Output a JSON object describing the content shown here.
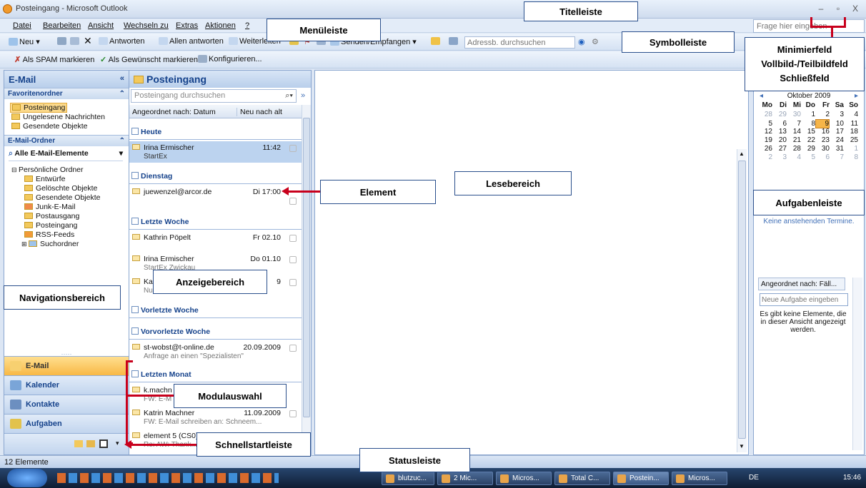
{
  "window": {
    "title": "Posteingang - Microsoft Outlook",
    "controls": [
      "–",
      "▫",
      "X"
    ]
  },
  "menu": [
    "Datei",
    "Bearbeiten",
    "Ansicht",
    "Wechseln zu",
    "Extras",
    "Aktionen",
    "?"
  ],
  "help_placeholder": "Frage hier eingeben",
  "toolbar1": {
    "new": "Neu",
    "reply": "Antworten",
    "reply_all": "Allen antworten",
    "forward": "Weiterleiten",
    "send_receive": "Senden/Empfangen",
    "address_search": "Adressb. durchsuchen"
  },
  "toolbar2": {
    "spam": "Als SPAM markieren",
    "wanted": "Als Gewünscht markieren",
    "configure": "Konfigurieren..."
  },
  "nav": {
    "title": "E-Mail",
    "favorites_header": "Favoritenordner",
    "favorites": [
      "Posteingang",
      "Ungelesene Nachrichten",
      "Gesendete Objekte"
    ],
    "mail_folders_header": "E-Mail-Ordner",
    "all_items": "Alle E-Mail-Elemente",
    "personal_folders": "Persönliche Ordner",
    "folders": [
      "Entwürfe",
      "Gelöschte Objekte",
      "Gesendete Objekte",
      "Junk-E-Mail",
      "Postausgang",
      "Posteingang",
      "RSS-Feeds",
      "Suchordner"
    ],
    "modules": [
      "E-Mail",
      "Kalender",
      "Kontakte",
      "Aufgaben"
    ]
  },
  "list": {
    "title": "Posteingang",
    "search_placeholder": "Posteingang durchsuchen",
    "sort_by": "Angeordnet nach: Datum",
    "sort_order": "Neu nach alt",
    "groups": [
      "Heute",
      "Dienstag",
      "Letzte Woche",
      "Vorletzte Woche",
      "Vorvorletzte Woche",
      "Letzten Monat"
    ],
    "messages": [
      {
        "from": "Irina Ermischer",
        "date": "11:42",
        "subject": "StartEx"
      },
      {
        "from": "juewenzel@arcor.de",
        "date": "Di 17:00",
        "subject": ""
      },
      {
        "from": "Kathrin Pöpelt",
        "date": "Fr 02.10",
        "subject": ""
      },
      {
        "from": "Irina Ermischer",
        "date": "Do 01.10",
        "subject": "StartEx Zwickau"
      },
      {
        "from": "Ka",
        "date": "9",
        "subject": "Nu"
      },
      {
        "from": "st-wobst@t-online.de",
        "date": "20.09.2009",
        "subject": "Anfrage an einen \"Spezialisten\""
      },
      {
        "from": "k.machn",
        "date": "",
        "subject": "FW: E-M"
      },
      {
        "from": "Katrin Machner",
        "date": "11.09.2009",
        "subject": "FW: E-Mail schreiben an: Schneem..."
      },
      {
        "from": "element 5 (CS0)",
        "date": "",
        "subject": "Re: AW: Thank..."
      }
    ]
  },
  "todo": {
    "month": "Oktober 2009",
    "weekdays": [
      "Mo",
      "Di",
      "Mi",
      "Do",
      "Fr",
      "Sa",
      "So"
    ],
    "weeks": [
      [
        "28",
        "29",
        "30",
        "1",
        "2",
        "3",
        "4"
      ],
      [
        "5",
        "6",
        "7",
        "8",
        "9",
        "10",
        "11"
      ],
      [
        "12",
        "13",
        "14",
        "15",
        "16",
        "17",
        "18"
      ],
      [
        "19",
        "20",
        "21",
        "22",
        "23",
        "24",
        "25"
      ],
      [
        "26",
        "27",
        "28",
        "29",
        "30",
        "31",
        "1"
      ],
      [
        "2",
        "3",
        "4",
        "5",
        "6",
        "7",
        "8"
      ]
    ],
    "no_appointments": "Keine anstehenden Termine.",
    "tasks_sort": "Angeordnet nach: Fäll...",
    "new_task_placeholder": "Neue Aufgabe eingeben",
    "no_tasks": "Es gibt keine Elemente, die in dieser Ansicht angezeigt werden."
  },
  "status": "12 Elemente",
  "taskbar": {
    "buttons": [
      "blutzuc...",
      "2 Mic...",
      "Micros...",
      "Total C...",
      "Postein...",
      "Micros..."
    ],
    "lang": "DE",
    "clock": "15:46"
  },
  "labels": {
    "titelleiste": "Titelleiste",
    "menueleiste": "Menüleiste",
    "symbolleiste": "Symbolleiste",
    "fenster": "Minimierfeld\nVollbild-/Teilbildfeld\nSchließfeld",
    "lesebereich": "Lesebereich",
    "element": "Element",
    "aufgabenleiste": "Aufgabenleiste",
    "anzeigebereich": "Anzeigebereich",
    "navigationsbereich": "Navigationsbereich",
    "modulauswahl": "Modulauswahl",
    "schnellstartleiste": "Schnellstartleiste",
    "statusleiste": "Statusleiste"
  }
}
